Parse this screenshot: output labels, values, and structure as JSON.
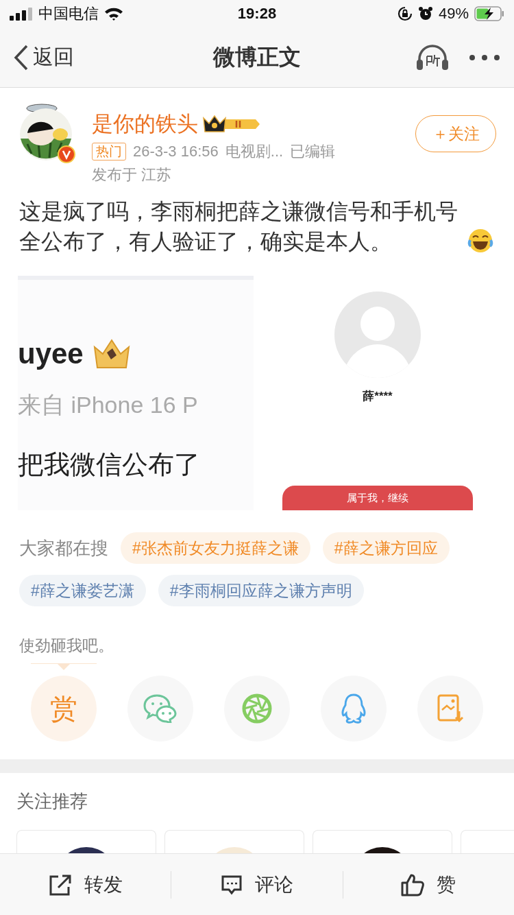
{
  "status_bar": {
    "carrier": "中国电信",
    "time": "19:28",
    "battery": "49%"
  },
  "nav": {
    "back": "返回",
    "title": "微博正文"
  },
  "post": {
    "author": "是你的铁头",
    "verified": true,
    "follow": "＋关注",
    "hot_badge": "热门",
    "time": "26-3-3 16:56",
    "source": "电视剧...",
    "edited": "已编辑",
    "location": "发布于 江苏",
    "text": "这是疯了吗，李雨桐把薛之谦微信号和手机号全公布了，有人验证了，确实是本人。",
    "images": [
      {
        "kind": "post-screenshot",
        "lines": [
          "uyee",
          "来自 iPhone 16 P",
          "把我微信公布了"
        ]
      },
      {
        "kind": "contact-screenshot",
        "name": "薛****",
        "button": "属于我，继续"
      }
    ]
  },
  "search": {
    "label": "大家都在搜",
    "tags": [
      {
        "text": "#张杰前女友力挺薛之谦",
        "kind": "hot"
      },
      {
        "text": "#薛之谦方回应",
        "kind": "hot"
      },
      {
        "text": "#薛之谦娄艺潇",
        "kind": "normal"
      },
      {
        "text": "#李雨桐回应薛之谦方声明",
        "kind": "normal"
      }
    ]
  },
  "share": {
    "prompt": "使劲砸我吧。",
    "items": [
      {
        "kind": "reward",
        "label": "赏",
        "selected": true
      },
      {
        "kind": "wechat",
        "selected": false
      },
      {
        "kind": "moments",
        "selected": false
      },
      {
        "kind": "qq",
        "selected": false
      },
      {
        "kind": "save-image",
        "selected": false
      }
    ]
  },
  "recommend": {
    "title": "关注推荐",
    "cards": [
      {
        "kind": "picture"
      },
      {
        "kind": "picture"
      },
      {
        "kind": "picture"
      },
      {
        "kind": "blank"
      }
    ]
  },
  "actions": [
    {
      "kind": "repost",
      "label": "转发"
    },
    {
      "kind": "comment",
      "label": "评论"
    },
    {
      "kind": "like",
      "label": "赞"
    }
  ]
}
